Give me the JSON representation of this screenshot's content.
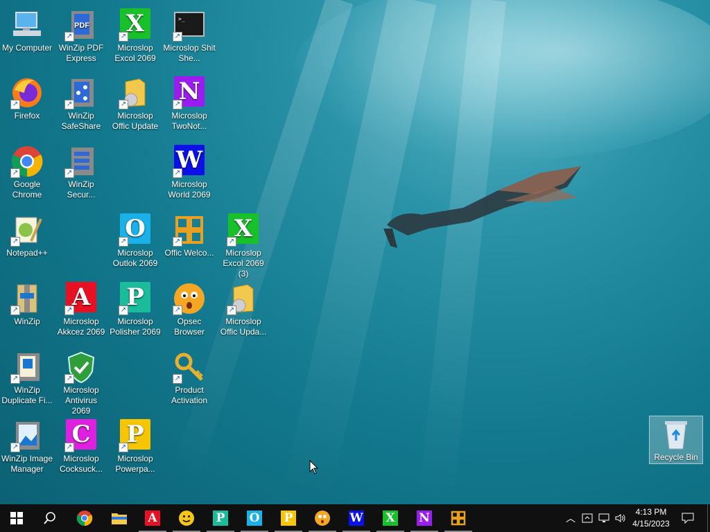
{
  "desktop_icons": [
    {
      "label": "My Computer",
      "icon": "computer-icon"
    },
    {
      "label": "WinZip PDF Express",
      "icon": "winzip-pdf-icon"
    },
    {
      "label": "Microslop Excol 2069",
      "icon": "excel-icon"
    },
    {
      "label": "Microslop Shit She...",
      "icon": "terminal-icon"
    },
    {
      "label": "Firefox",
      "icon": "firefox-icon"
    },
    {
      "label": "WinZip SafeShare",
      "icon": "winzip-share-icon"
    },
    {
      "label": "Microslop Offic Update",
      "icon": "office-update-icon"
    },
    {
      "label": "Microslop TwoNot...",
      "icon": "onenote-icon"
    },
    {
      "label": "Google Chrome",
      "icon": "chrome-icon"
    },
    {
      "label": "WinZip Secur...",
      "icon": "winzip-secure-icon"
    },
    {
      "label": "Microslop World 2069",
      "icon": "word-icon"
    },
    {
      "label": "Notepad++",
      "icon": "notepad-icon"
    },
    {
      "label": "Microslop Outlok 2069",
      "icon": "outlook-icon"
    },
    {
      "label": "Offic Welco...",
      "icon": "office-welcome-icon"
    },
    {
      "label": "Microslop Excol 2069 (3)",
      "icon": "excel-icon"
    },
    {
      "label": "WinZip",
      "icon": "winzip-icon"
    },
    {
      "label": "Microslop Akkcez 2069",
      "icon": "access-icon"
    },
    {
      "label": "Microslop Polisher 2069",
      "icon": "publisher-icon"
    },
    {
      "label": "Opsec Browser",
      "icon": "opsec-browser-icon"
    },
    {
      "label": "Microslop Offic Upda...",
      "icon": "office-update-icon"
    },
    {
      "label": "WinZip Duplicate Fi...",
      "icon": "winzip-duplicate-icon"
    },
    {
      "label": "Microslop Antivirus 2069",
      "icon": "antivirus-shield-icon"
    },
    {
      "label": "Product Activation",
      "icon": "key-icon"
    },
    {
      "label": "WinZip Image Manager",
      "icon": "winzip-image-icon"
    },
    {
      "label": "Microslop Cocksuck...",
      "icon": "pink-c-icon"
    },
    {
      "label": "Microslop Powerpa...",
      "icon": "powerpoint-icon"
    }
  ],
  "recycle_bin": {
    "label": "Recycle Bin"
  },
  "taskbar": {
    "apps": [
      "start-icon",
      "search-icon",
      "chrome-icon",
      "file-explorer-icon",
      "access-icon",
      "opsec-browser-icon",
      "publisher-icon",
      "outlook-icon",
      "powerpoint-icon",
      "opsec-browser-icon",
      "word-icon",
      "excel-icon",
      "onenote-icon",
      "office-icon"
    ],
    "time": "4:13 PM",
    "date": "4/15/2023"
  },
  "colors": {
    "taskbar": "#101010",
    "water": "#137a8f"
  }
}
